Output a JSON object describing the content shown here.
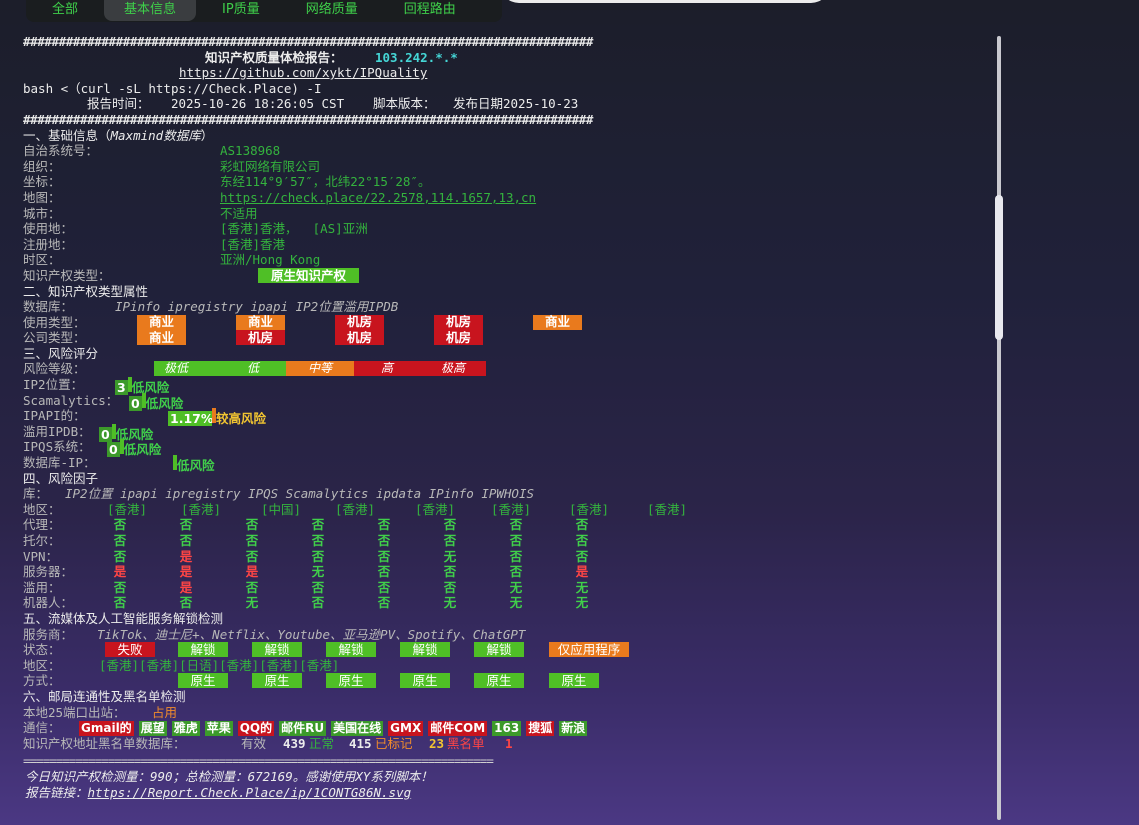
{
  "tabs": [
    "全部",
    "基本信息",
    "IP质量",
    "网络质量",
    "回程路由"
  ],
  "active_tab": 1,
  "header": {
    "hash_line": "################################################################################",
    "title": "知识产权质量体检报告：",
    "ip": "103.242.*.*",
    "repo": "https://github.com/xykt/IPQuality",
    "cmd": "bash <（curl -sL https://Check.Place) -I",
    "report_time_label": "报告时间：",
    "report_time": "2025-10-26 18:26:05 CST",
    "version_label": "脚本版本：",
    "version": "发布日期2025-10-23"
  },
  "basic": {
    "title": "一、基础信息（",
    "title_db": "Maxmind数据库",
    "title_end": "）",
    "rows": [
      {
        "label": "自治系统号：",
        "value": "AS138968"
      },
      {
        "label": "组织：",
        "value": "彩虹网络有限公司"
      },
      {
        "label": "坐标：",
        "value": "东经114°9′57″，北纬22°15′28″。"
      },
      {
        "label": "地图：",
        "value": "https://check.place/22.2578,114.1657,13,cn"
      },
      {
        "label": "城市：",
        "value": "不适用"
      },
      {
        "label": "使用地：",
        "value": "[香港]香港，  [AS]亚洲"
      },
      {
        "label": "注册地：",
        "value": "[香港]香港"
      },
      {
        "label": "时区：",
        "value": "亚洲/Hong Kong"
      }
    ],
    "type_label": "知识产权类型：",
    "type_value": "原生知识产权"
  },
  "type_attr": {
    "title": "二、知识产权类型属性",
    "db_label": "数据库：",
    "db_list": "IPinfo ipregistry ipapi IP2位置滥用IPDB",
    "usage_label": "使用类型：",
    "usage": [
      {
        "text": "商业",
        "color": "orange"
      },
      {
        "text": "商业",
        "color": "orange"
      },
      {
        "text": "机房",
        "color": "red"
      },
      {
        "text": "机房",
        "color": "red"
      },
      {
        "text": "商业",
        "color": "orange"
      }
    ],
    "company_label": "公司类型：",
    "company": [
      {
        "text": "商业",
        "color": "orange"
      },
      {
        "text": "机房",
        "color": "red"
      },
      {
        "text": "机房",
        "color": "red"
      },
      {
        "text": "机房",
        "color": "red"
      }
    ]
  },
  "risk": {
    "title": "三、风险评分",
    "level_label": "风险等级：",
    "scale": [
      {
        "text": "极低",
        "color": "#4fbf26"
      },
      {
        "text": "低",
        "color": "#4fbf26"
      },
      {
        "text": "中等",
        "color": "#e97a1d"
      },
      {
        "text": "高",
        "color": "#c8141e"
      },
      {
        "text": "极高",
        "color": "#c8141e"
      }
    ],
    "items": [
      {
        "label": "IP2位置：",
        "score": "3",
        "text": "低风险",
        "tone": "green"
      },
      {
        "label": "Scamalytics：",
        "score": "0",
        "text": "低风险",
        "tone": "green"
      },
      {
        "label": "IPAPI的：",
        "score": "1.17%",
        "text": "较高风险",
        "tone": "orange"
      },
      {
        "label": "滥用IPDB：",
        "score": "0",
        "text": "低风险",
        "tone": "green"
      },
      {
        "label": "IPQS系统：",
        "score": "0",
        "text": "低风险",
        "tone": "green"
      },
      {
        "label": "数据库-IP：",
        "score": "",
        "text": "低风险",
        "tone": "green"
      }
    ]
  },
  "factors": {
    "title": "四、风险因子",
    "lib_label": "库：",
    "lib_list": "IP2位置 ipapi ipregistry IPQS Scamalytics ipdata IPinfo IPWHOIS",
    "region_label": "地区：",
    "regions": [
      "[香港]",
      "[香港]",
      "[中国]",
      "[香港]",
      "[香港]",
      "[香港]",
      "[香港]",
      "[香港]"
    ],
    "rows": [
      {
        "label": "代理：",
        "vals": [
          "否",
          "否",
          "否",
          "否",
          "否",
          "否",
          "否",
          "否"
        ]
      },
      {
        "label": "托尔：",
        "vals": [
          "否",
          "否",
          "否",
          "否",
          "否",
          "否",
          "否",
          "否"
        ]
      },
      {
        "label": "VPN：",
        "vals": [
          "否",
          "是",
          "否",
          "否",
          "否",
          "无",
          "否",
          "否"
        ]
      },
      {
        "label": "服务器：",
        "vals": [
          "是",
          "是",
          "是",
          "无",
          "否",
          "否",
          "否",
          "是"
        ]
      },
      {
        "label": "滥用：",
        "vals": [
          "否",
          "是",
          "否",
          "否",
          "否",
          "否",
          "无",
          "无"
        ]
      },
      {
        "label": "机器人：",
        "vals": [
          "否",
          "否",
          "无",
          "否",
          "否",
          "无",
          "无",
          "无"
        ]
      }
    ]
  },
  "streaming": {
    "title": "五、流媒体及人工智能服务解锁检测",
    "service_label": "服务商：",
    "services": "TikTok、迪士尼+、Netflix、Youtube、亚马逊PV、Spotify、ChatGPT",
    "status_label": "状态：",
    "status": [
      {
        "text": "失败",
        "color": "red"
      },
      {
        "text": "解锁",
        "color": "green"
      },
      {
        "text": "解锁",
        "color": "green"
      },
      {
        "text": "解锁",
        "color": "green"
      },
      {
        "text": "解锁",
        "color": "green"
      },
      {
        "text": "解锁",
        "color": "green"
      },
      {
        "text": "仅应用程序",
        "color": "orange"
      }
    ],
    "region_label": "地区：",
    "regions": "[香港][香港][日语][香港][香港][香港]",
    "method_label": "方式：",
    "methods": [
      "原生",
      "原生",
      "原生",
      "原生",
      "原生",
      "原生"
    ]
  },
  "mail": {
    "title": "六、邮局连通性及黑名单检测",
    "port_label": "本地25端口出站：",
    "port_value": "占用",
    "conn_label": "通信：",
    "providers": [
      {
        "text": "Gmail的",
        "color": "red"
      },
      {
        "text": "展望",
        "color": "green"
      },
      {
        "text": "雅虎",
        "color": "green"
      },
      {
        "text": "苹果",
        "color": "green"
      },
      {
        "text": "QQ的",
        "color": "red"
      },
      {
        "text": "邮件RU",
        "color": "green"
      },
      {
        "text": "美国在线",
        "color": "green"
      },
      {
        "text": "GMX",
        "color": "red"
      },
      {
        "text": "邮件COM",
        "color": "red"
      },
      {
        "text": "163",
        "color": "green"
      },
      {
        "text": "搜狐",
        "color": "red"
      },
      {
        "text": "新浪",
        "color": "green"
      }
    ],
    "bl_label": "知识产权地址黑名单数据库：",
    "bl_valid_label": "有效",
    "bl_valid": "439",
    "bl_normal_label": "正常",
    "bl_normal": "415",
    "bl_marked_label": "已标记",
    "bl_marked": "23",
    "bl_black_label": "黑名单",
    "bl_black": "1"
  },
  "footer": {
    "sep": "========================================================================",
    "stats": "今日知识产权检测量：990；总检测量：672169。感谢使用XY系列脚本！",
    "link_label": "报告链接：",
    "link": "https://Report.Check.Place/ip/1CONTG86N.svg"
  }
}
